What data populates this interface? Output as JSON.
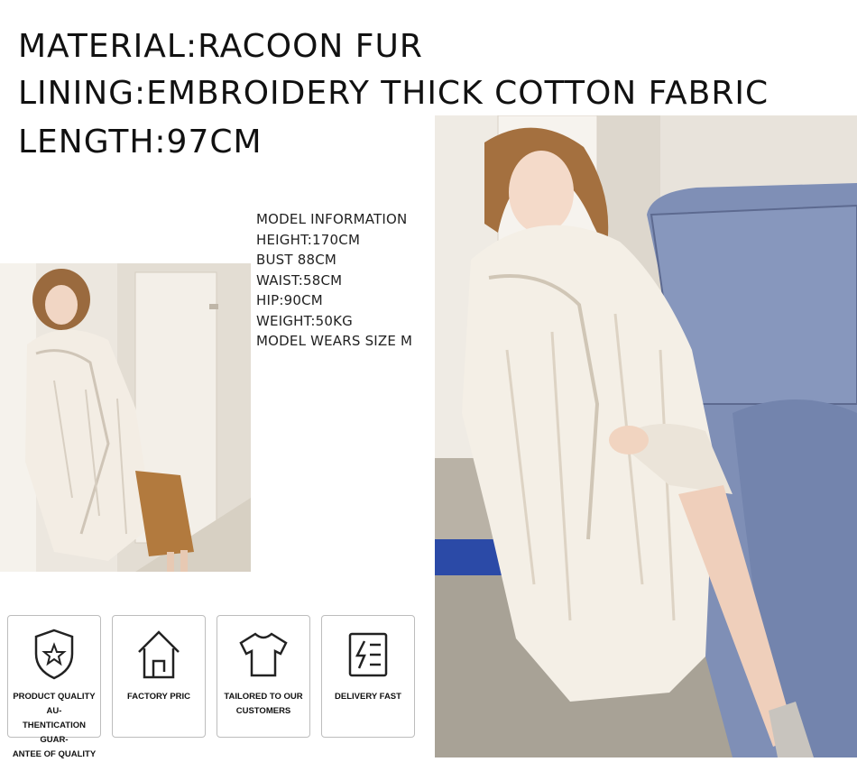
{
  "headline": {
    "material": "MATERIAL:RACOON FUR",
    "lining": "LINING:EMBROIDERY THICK COTTON FABRIC",
    "length": "LENGTH:97CM"
  },
  "model_info": {
    "title": "MODEL INFORMATION",
    "height": "HEIGHT:170CM",
    "bust": "BUST 88CM",
    "waist": "WAIST:58CM",
    "hip": "HIP:90CM",
    "weight": "WEIGHT:50KG",
    "size": "MODEL WEARS SIZE M"
  },
  "features": [
    {
      "icon": "shield-star-icon",
      "label_lines": [
        "PRODUCT QUALITY AU-",
        "THENTICATION  GUAR-",
        "ANTEE OF QUALITY"
      ]
    },
    {
      "icon": "house-icon",
      "label_lines": [
        "FACTORY PRIC"
      ]
    },
    {
      "icon": "tshirt-icon",
      "label_lines": [
        "TAILORED TO OUR",
        "CUSTOMERS"
      ]
    },
    {
      "icon": "delivery-icon",
      "label_lines": [
        "DELIVERY FAST"
      ]
    }
  ]
}
